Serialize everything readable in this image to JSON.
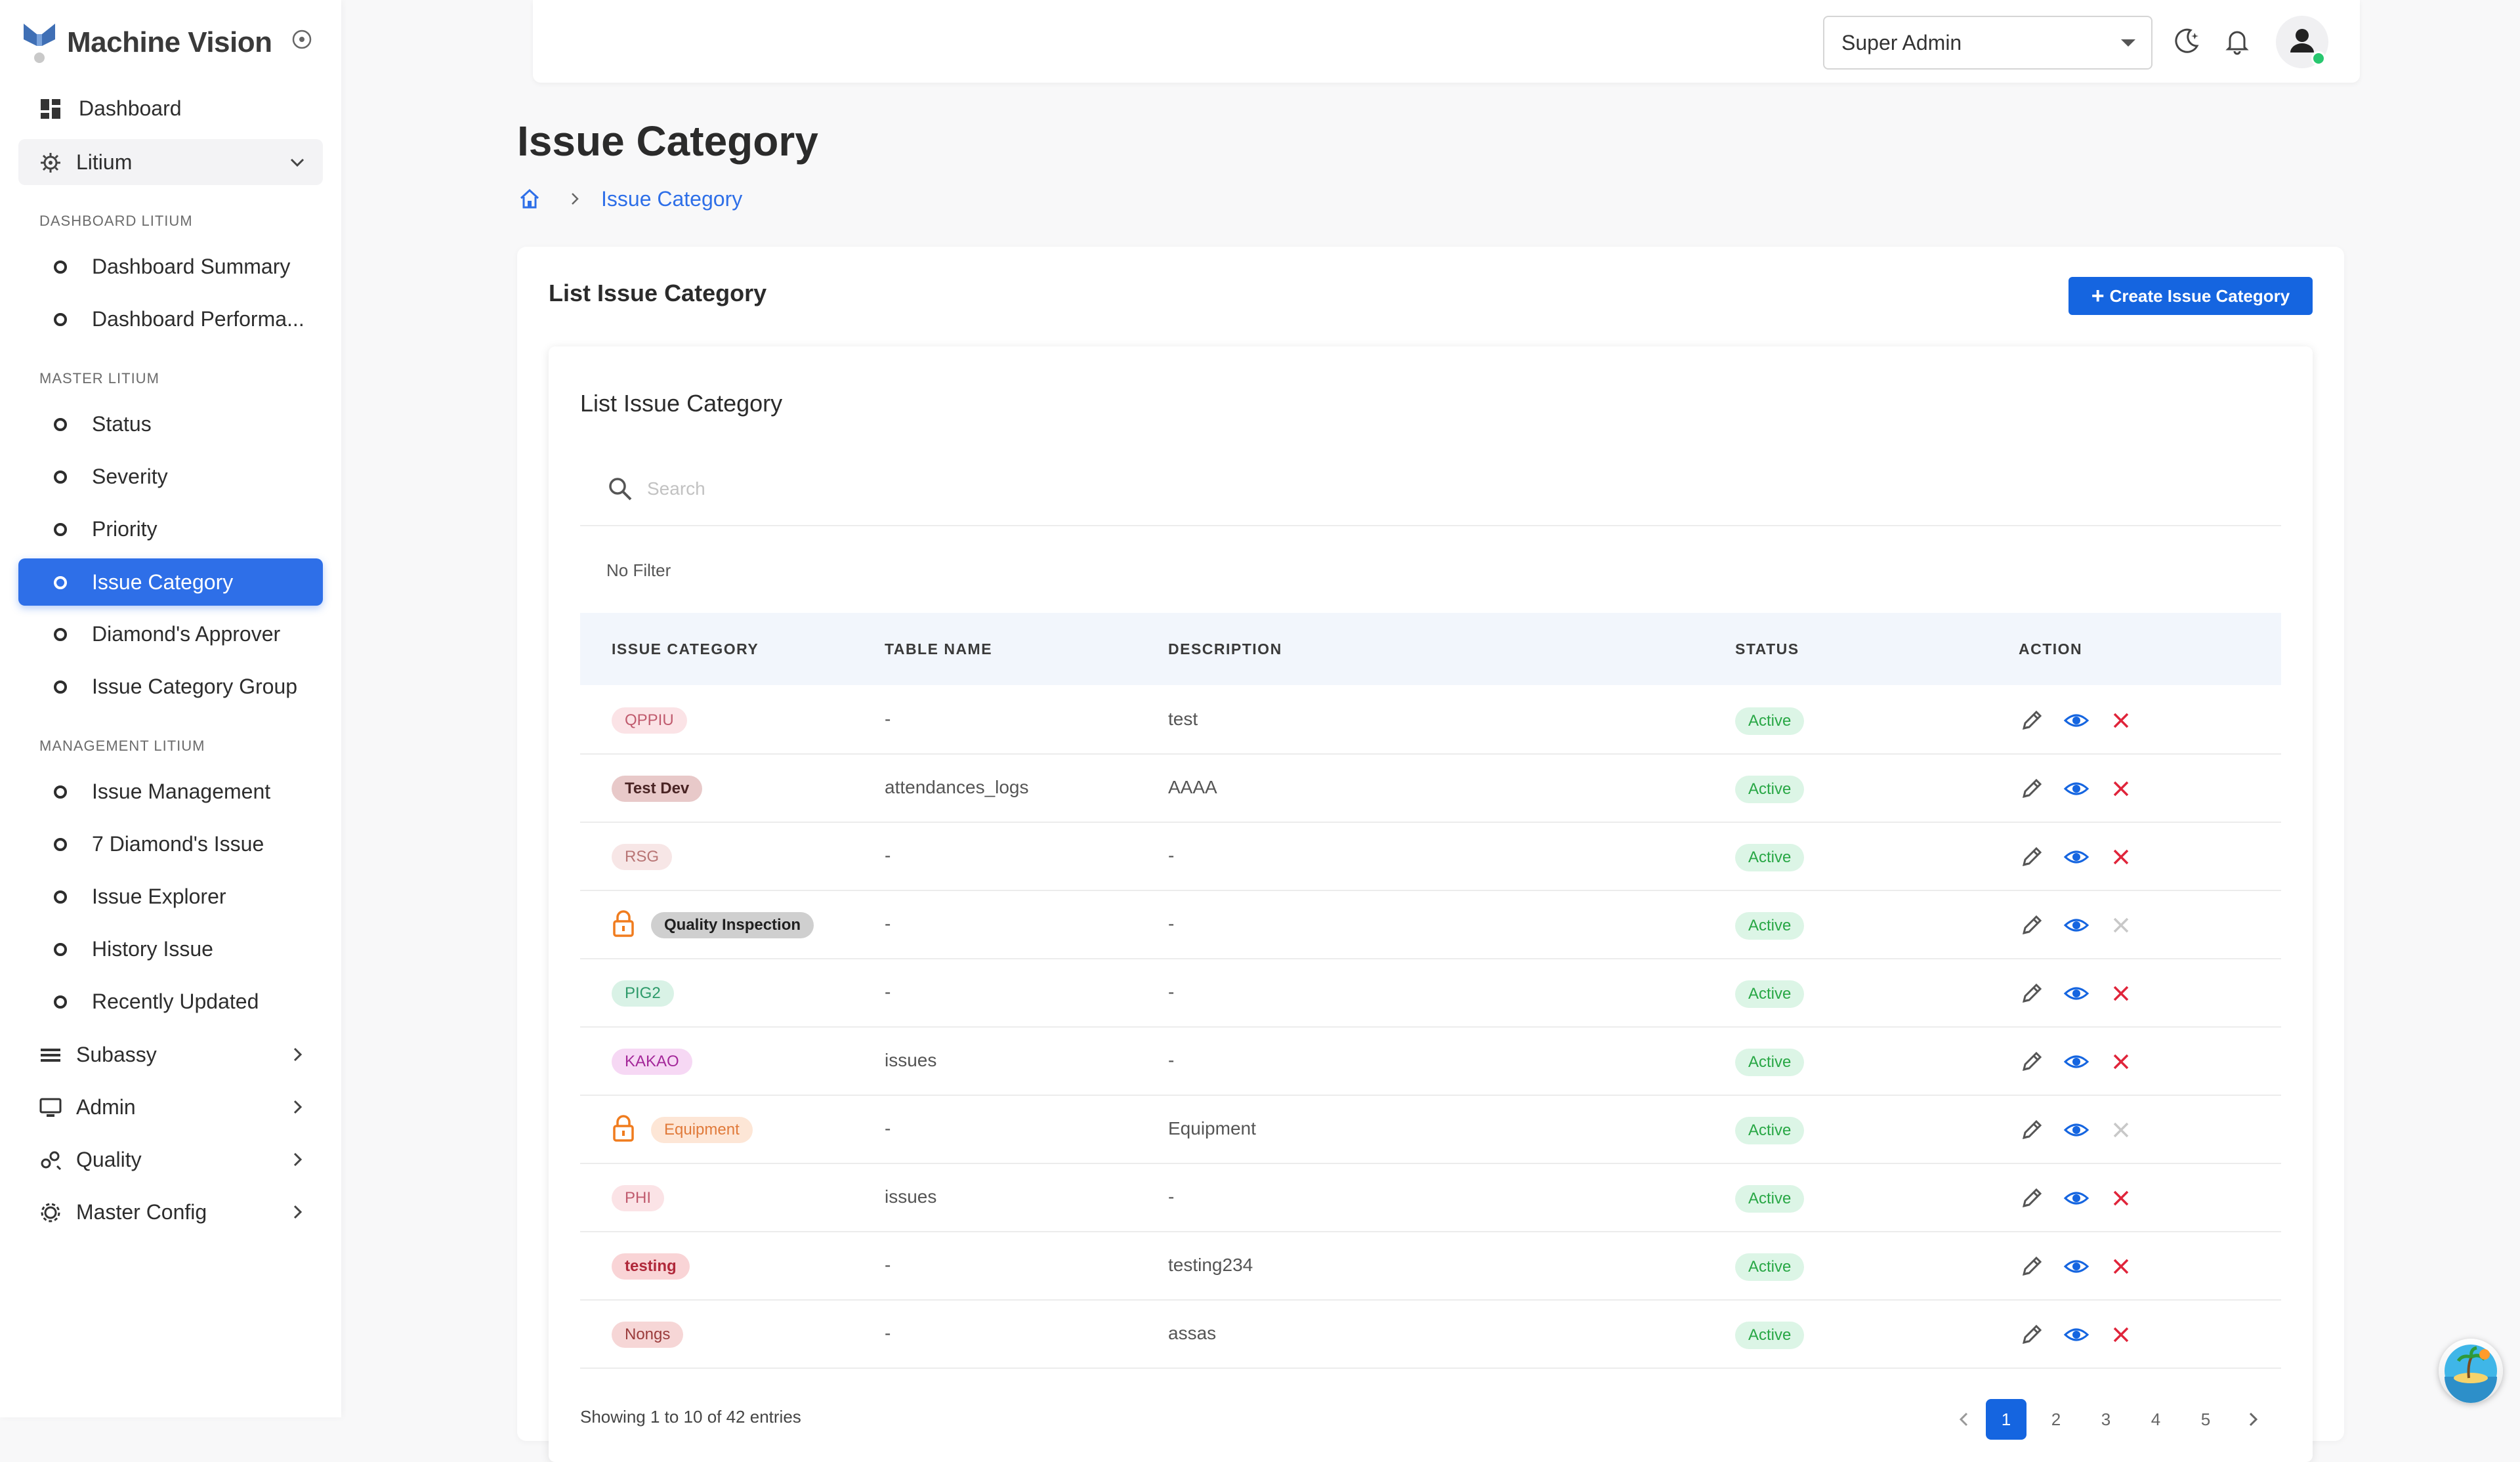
{
  "brand": {
    "name": "Machine Vision"
  },
  "sidebar": {
    "dashboard_label": "Dashboard",
    "litium_label": "Litium",
    "sections": [
      {
        "title": "DASHBOARD LITIUM",
        "items": [
          "Dashboard Summary",
          "Dashboard Performa..."
        ]
      },
      {
        "title": "MASTER LITIUM",
        "items": [
          "Status",
          "Severity",
          "Priority",
          "Issue Category",
          "Diamond's Approver",
          "Issue Category Group"
        ]
      },
      {
        "title": "MANAGEMENT LITIUM",
        "items": [
          "Issue Management",
          "7 Diamond's Issue",
          "Issue Explorer",
          "History Issue",
          "Recently Updated"
        ]
      }
    ],
    "active_item": "Issue Category",
    "groups": [
      "Subassy",
      "Admin",
      "Quality",
      "Master Config"
    ]
  },
  "header": {
    "role_selected": "Super Admin",
    "icons": [
      "moon-icon",
      "bell-icon",
      "user-icon"
    ]
  },
  "page": {
    "title": "Issue Category",
    "breadcrumb_current": "Issue Category"
  },
  "card": {
    "title": "List Issue Category",
    "create_button": "Create Issue Category",
    "inner_title": "List Issue Category",
    "search_placeholder": "Search",
    "filter_label": "No Filter"
  },
  "table": {
    "columns": [
      "ISSUE CATEGORY",
      "TABLE NAME",
      "DESCRIPTION",
      "STATUS",
      "ACTION"
    ],
    "rows": [
      {
        "category": "QPPIU",
        "bg": "#fbe3e6",
        "fg": "#c05b6e",
        "bold": false,
        "locked": false,
        "table_name": "-",
        "description": "test",
        "status": "Active",
        "deletable": true
      },
      {
        "category": "Test Dev",
        "bg": "#e8c9c9",
        "fg": "#4a2424",
        "bold": true,
        "locked": false,
        "table_name": "attendances_logs",
        "description": "AAAA",
        "status": "Active",
        "deletable": true
      },
      {
        "category": "RSG",
        "bg": "#f7e6e6",
        "fg": "#b87575",
        "bold": false,
        "locked": false,
        "table_name": "-",
        "description": "-",
        "status": "Active",
        "deletable": true
      },
      {
        "category": "Quality Inspection",
        "bg": "#cfcfcf",
        "fg": "#1f1f1f",
        "bold": true,
        "locked": true,
        "table_name": "-",
        "description": "-",
        "status": "Active",
        "deletable": false
      },
      {
        "category": "PIG2",
        "bg": "#d9f2e6",
        "fg": "#2e9a6a",
        "bold": false,
        "locked": false,
        "table_name": "-",
        "description": "-",
        "status": "Active",
        "deletable": true
      },
      {
        "category": "KAKAO",
        "bg": "#f6d8f4",
        "fg": "#a4289a",
        "bold": false,
        "locked": false,
        "table_name": "issues",
        "description": "-",
        "status": "Active",
        "deletable": true
      },
      {
        "category": "Equipment",
        "bg": "#fde6d6",
        "fg": "#e07a3a",
        "bold": false,
        "locked": true,
        "table_name": "-",
        "description": "Equipment",
        "status": "Active",
        "deletable": false
      },
      {
        "category": "PHI",
        "bg": "#fbe3e6",
        "fg": "#c05b6e",
        "bold": false,
        "locked": false,
        "table_name": "issues",
        "description": "-",
        "status": "Active",
        "deletable": true
      },
      {
        "category": "testing",
        "bg": "#f9d4d6",
        "fg": "#b0283a",
        "bold": true,
        "locked": false,
        "table_name": "-",
        "description": "testing234",
        "status": "Active",
        "deletable": true
      },
      {
        "category": "Nongs",
        "bg": "#f6d6d6",
        "fg": "#9a3b3b",
        "bold": false,
        "locked": false,
        "table_name": "-",
        "description": "assas",
        "status": "Active",
        "deletable": true
      }
    ]
  },
  "pagination": {
    "info": "Showing 1 to 10 of 42 entries",
    "pages": [
      "1",
      "2",
      "3",
      "4",
      "5"
    ],
    "current": "1"
  },
  "colors": {
    "primary": "#1565e0",
    "sidebar_active": "#2e6fe8",
    "status_bg": "#dcf5e6",
    "status_fg": "#28a745",
    "edit": "#555555",
    "view": "#1565e0",
    "delete": "#e0243a",
    "delete_disabled": "#c8c8c8",
    "lock": "#f07c1e"
  }
}
